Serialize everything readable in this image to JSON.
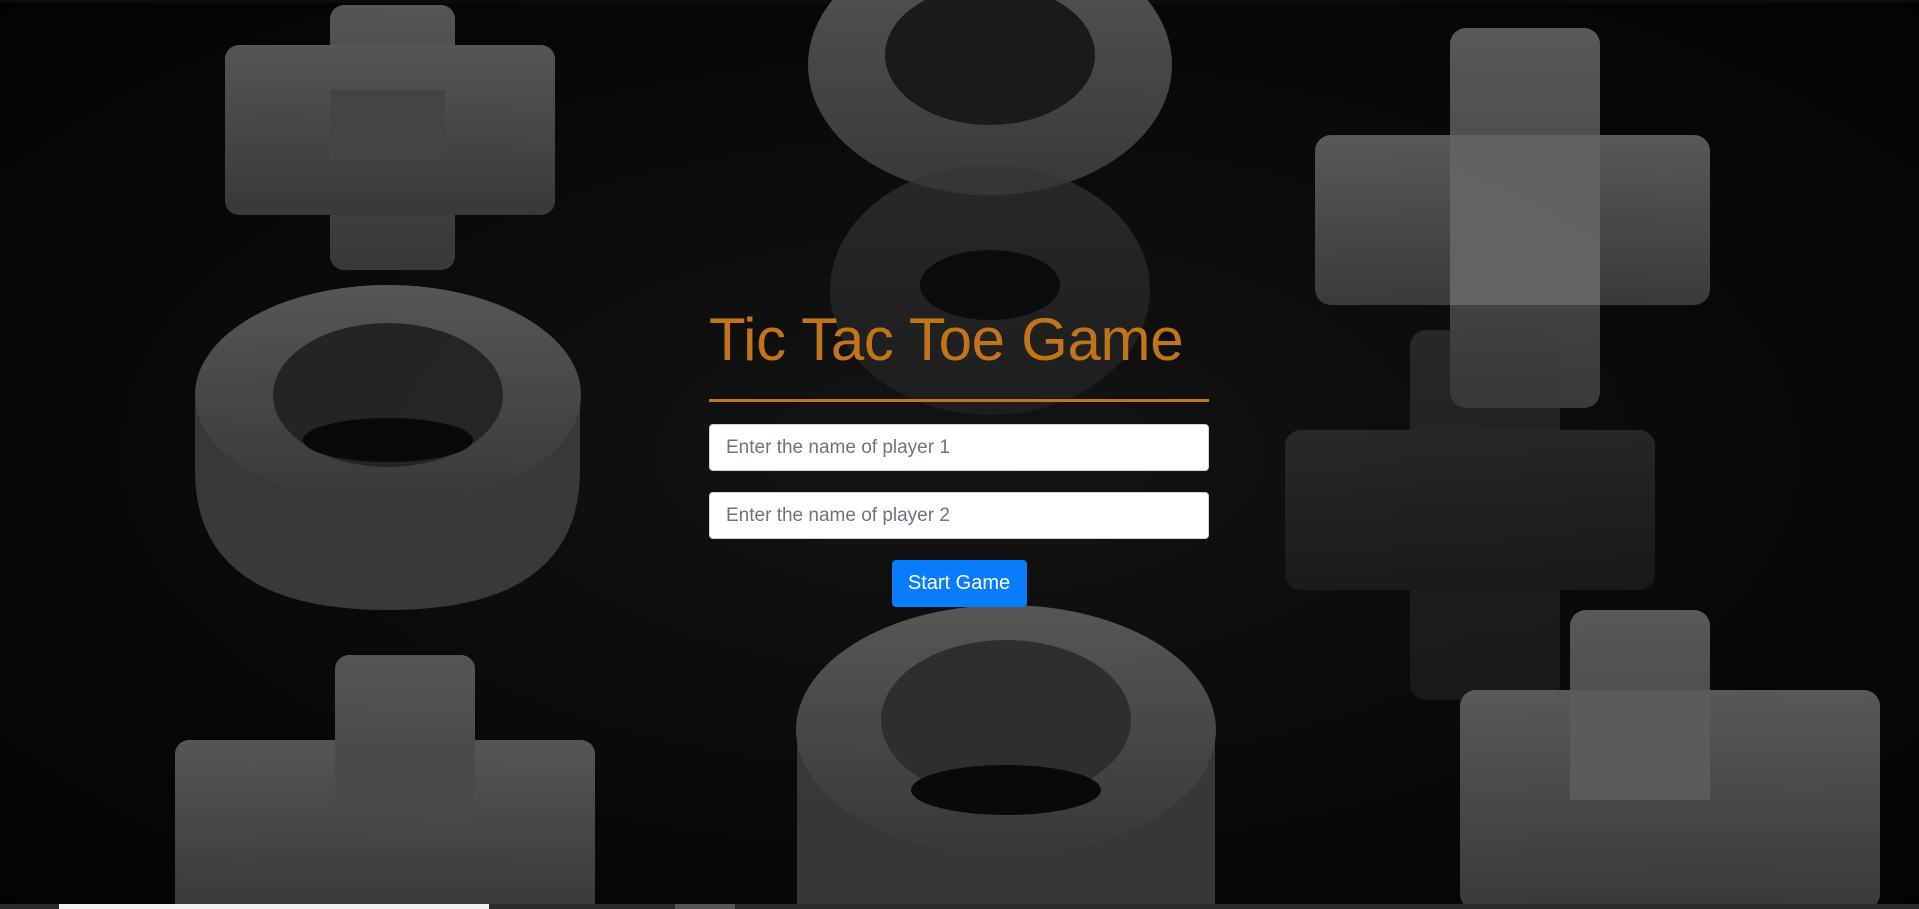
{
  "title": "Tic Tac Toe Game",
  "player1": {
    "placeholder": "Enter the name of player 1",
    "value": ""
  },
  "player2": {
    "placeholder": "Enter the name of player 2",
    "value": ""
  },
  "start_button": {
    "label": "Start Game"
  },
  "colors": {
    "title": "#c1741a",
    "divider": "#c1741a",
    "button": "#0a7cf9",
    "background": "#0d0d0d"
  },
  "background_image": {
    "description_icon": "frosted-glass-xo-pieces"
  }
}
